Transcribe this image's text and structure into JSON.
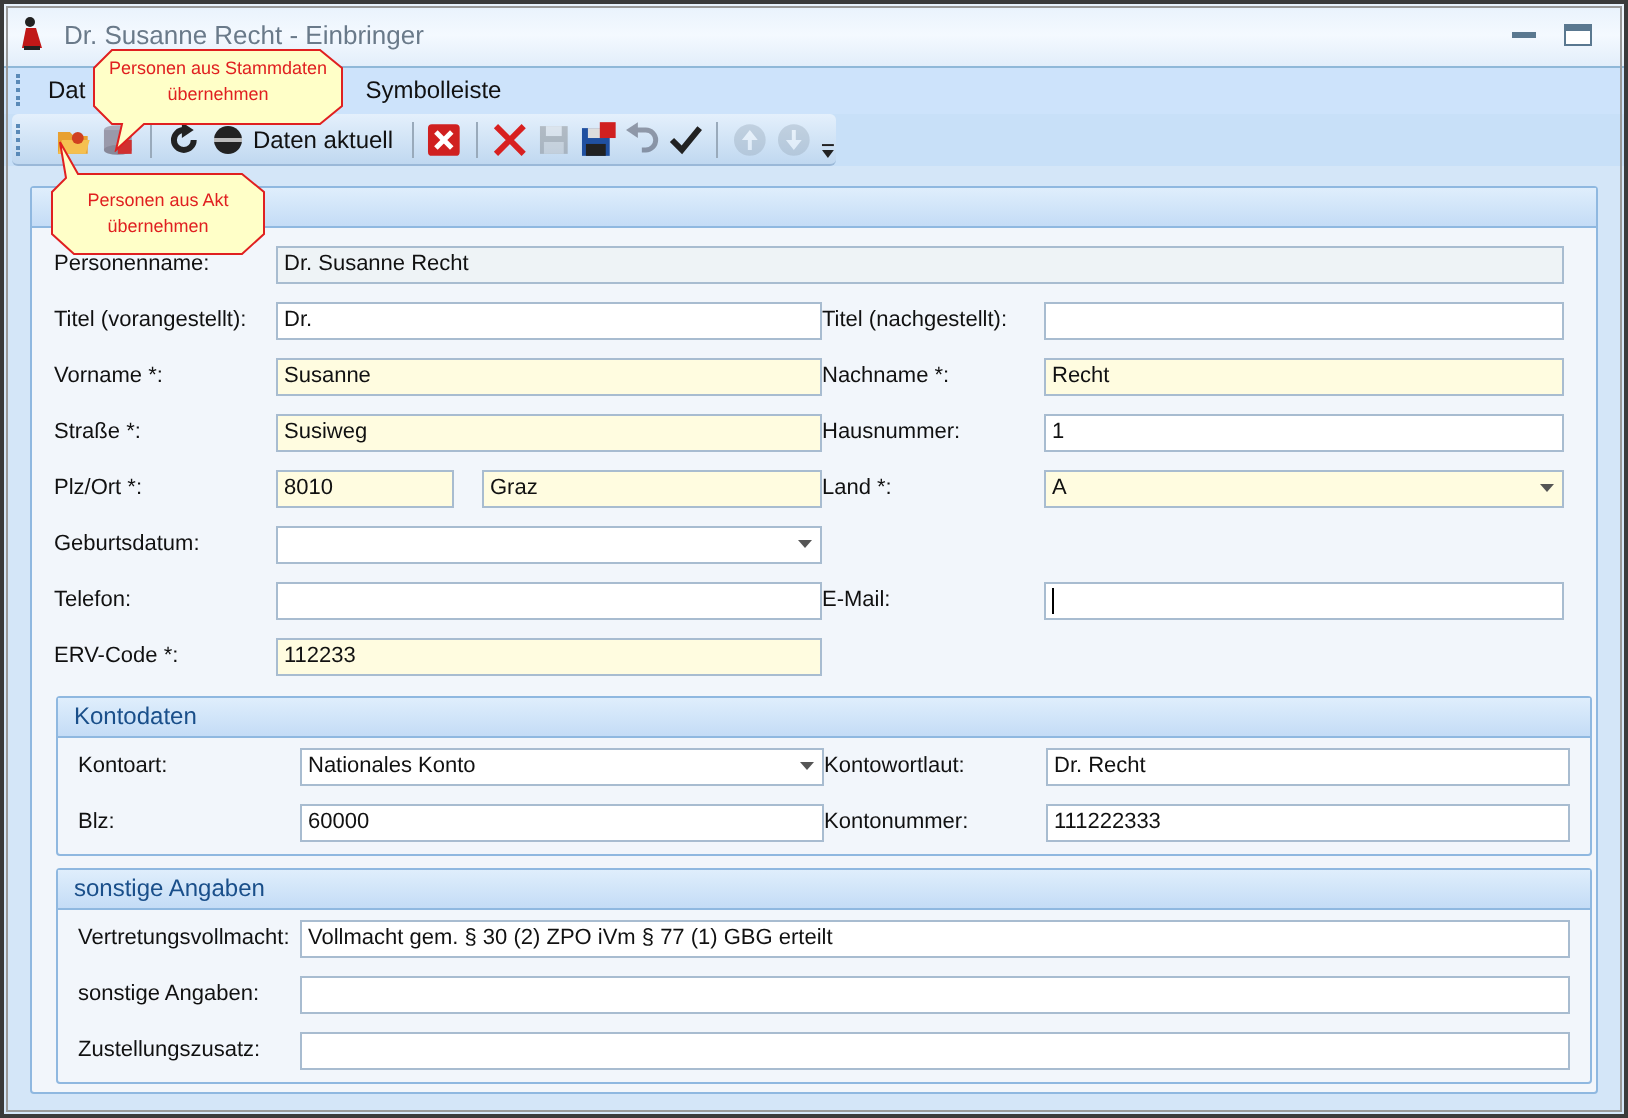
{
  "window": {
    "title": "Dr. Susanne Recht - Einbringer"
  },
  "menu": [
    {
      "label": "Dat"
    },
    {
      "label": "Symbolleiste"
    }
  ],
  "toolbar": [
    {
      "kind": "icon",
      "disabled": false
    },
    {
      "kind": "icon",
      "disabled": false
    },
    {
      "kind": "separator"
    },
    {
      "kind": "icon",
      "disabled": false
    },
    {
      "kind": "text",
      "label": "Daten aktuell",
      "disabled": false
    },
    {
      "kind": "separator"
    },
    {
      "kind": "icon",
      "disabled": false
    },
    {
      "kind": "separator"
    },
    {
      "kind": "icon",
      "disabled": false
    },
    {
      "kind": "icon",
      "disabled": true
    },
    {
      "kind": "icon",
      "disabled": false
    },
    {
      "kind": "icon",
      "disabled": true
    },
    {
      "kind": "icon",
      "disabled": false
    },
    {
      "kind": "separator"
    },
    {
      "kind": "icon",
      "disabled": true
    },
    {
      "kind": "icon",
      "disabled": true
    }
  ],
  "callouts": [
    {
      "text": "Personen aus Stammdaten übernehmen"
    },
    {
      "text": "Personen aus Akt übernehmen"
    }
  ],
  "person": {
    "name_row": {
      "label": "Personenname:",
      "value": "Dr. Susanne Recht"
    },
    "rows": [
      {
        "left": {
          "label": "Titel (vorangestellt):",
          "fields": [
            {
              "kind": "text",
              "value": "Dr.",
              "required": false
            }
          ]
        },
        "right": {
          "label": "Titel (nachgestellt):",
          "fields": [
            {
              "kind": "text",
              "required": false
            }
          ]
        }
      },
      {
        "left": {
          "label": "Vorname *:",
          "fields": [
            {
              "kind": "text",
              "value": "Susanne",
              "required": true
            }
          ]
        },
        "right": {
          "label": "Nachname *:",
          "fields": [
            {
              "kind": "text",
              "value": "Recht",
              "required": true
            }
          ]
        }
      },
      {
        "left": {
          "label": "Straße *:",
          "fields": [
            {
              "kind": "text",
              "value": "Susiweg",
              "required": true
            }
          ]
        },
        "right": {
          "label": "Hausnummer:",
          "fields": [
            {
              "kind": "text",
              "value": "1",
              "required": false
            }
          ]
        }
      },
      {
        "left": {
          "label": "Plz/Ort *:",
          "fields": [
            {
              "kind": "text",
              "value": "8010",
              "required": true
            },
            {
              "kind": "text",
              "value": "Graz",
              "required": true
            }
          ]
        },
        "right": {
          "label": "Land *:",
          "fields": [
            {
              "kind": "dropdown",
              "value": "A",
              "required": true
            }
          ]
        }
      },
      {
        "left": {
          "label": "Geburtsdatum:",
          "fields": [
            {
              "kind": "dropdown",
              "required": false
            }
          ]
        }
      },
      {
        "left": {
          "label": "Telefon:",
          "fields": [
            {
              "kind": "text",
              "required": false
            }
          ]
        },
        "right": {
          "label": "E-Mail:",
          "fields": [
            {
              "kind": "text",
              "required": false,
              "focused": true
            }
          ]
        }
      },
      {
        "left": {
          "label": "ERV-Code *:",
          "fields": [
            {
              "kind": "text",
              "value": "112233",
              "required": true
            }
          ]
        }
      }
    ]
  },
  "kontodaten": {
    "title": "Kontodaten",
    "rows": [
      {
        "left": {
          "label": "Kontoart:",
          "fields": [
            {
              "kind": "dropdown",
              "value": "Nationales Konto",
              "required": false
            }
          ]
        },
        "right": {
          "label": "Kontowortlaut:",
          "fields": [
            {
              "kind": "text",
              "value": "Dr. Recht",
              "required": false
            }
          ]
        }
      },
      {
        "left": {
          "label": "Blz:",
          "fields": [
            {
              "kind": "text",
              "value": "60000",
              "required": false
            }
          ]
        },
        "right": {
          "label": "Kontonummer:",
          "fields": [
            {
              "kind": "text",
              "value": "111222333",
              "required": false
            }
          ]
        }
      }
    ]
  },
  "sonstige": {
    "title": "sonstige Angaben",
    "rows": [
      {
        "label": "Vertretungsvollmacht:",
        "value": "Vollmacht gem. § 30 (2) ZPO iVm § 77 (1) GBG erteilt"
      },
      {
        "label": "sonstige Angaben:"
      },
      {
        "label": "Zustellungszusatz:"
      }
    ]
  }
}
